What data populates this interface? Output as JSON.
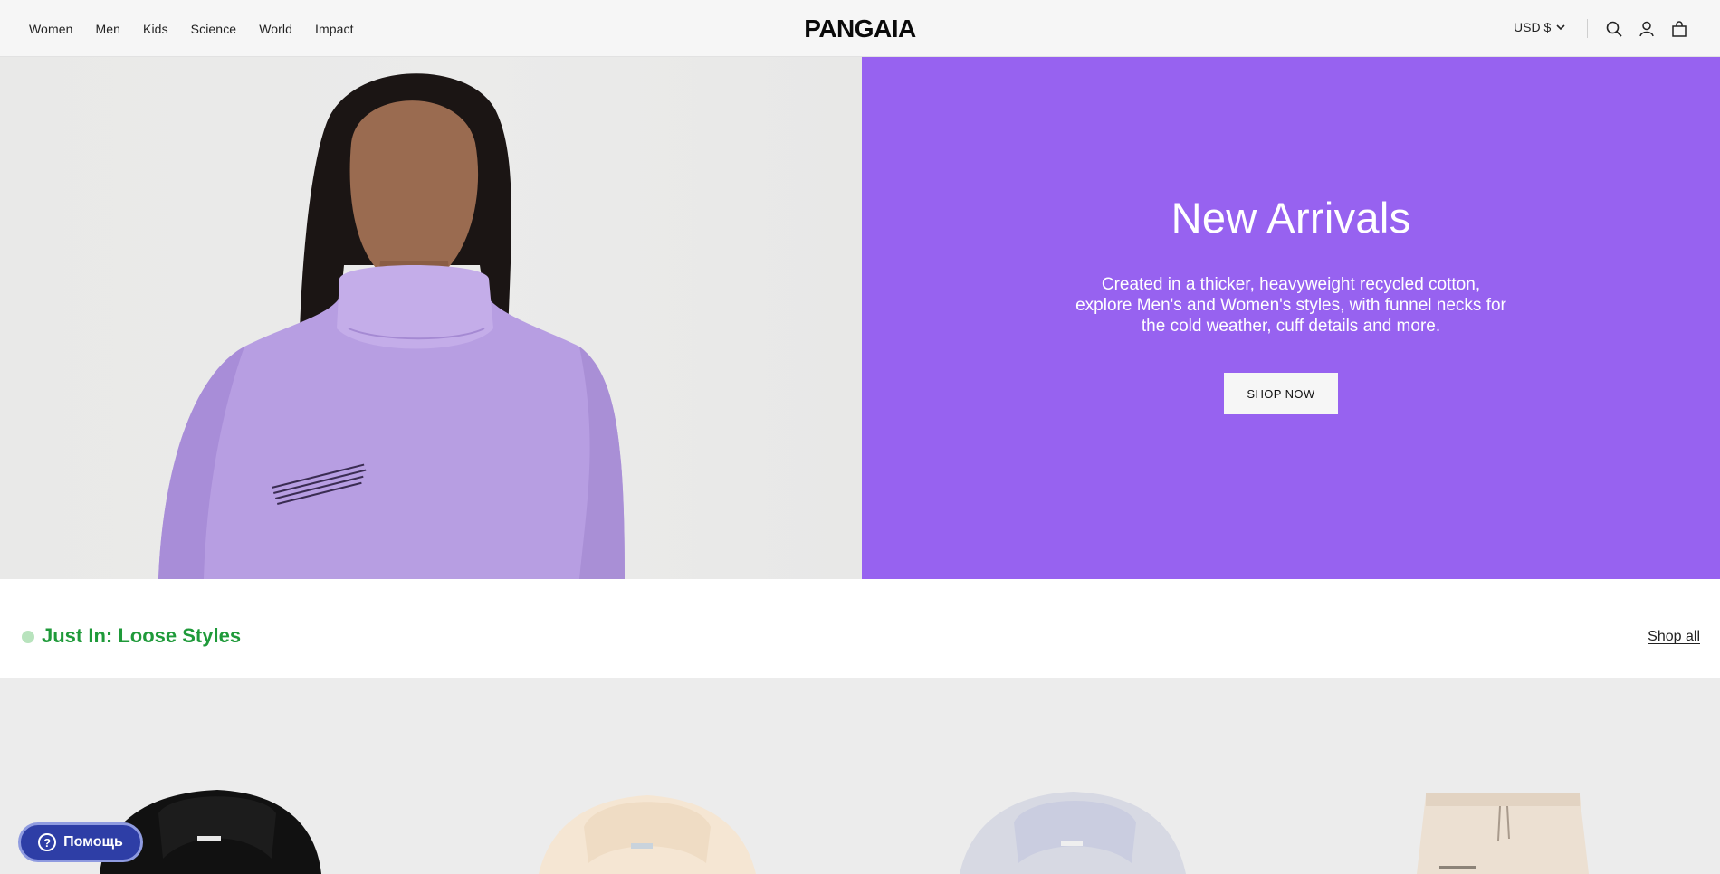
{
  "header": {
    "nav": [
      "Women",
      "Men",
      "Kids",
      "Science",
      "World",
      "Impact"
    ],
    "logo": "PANGAIA",
    "currency": "USD $",
    "icons": [
      "search-icon",
      "account-icon",
      "bag-icon"
    ]
  },
  "hero": {
    "title": "New Arrivals",
    "text": "Created in a thicker, heavyweight recycled cotton, explore Men's and Women's styles, with funnel necks for the cold weather, cuff details and more.",
    "button": "SHOP NOW",
    "panel_color": "#9762f0"
  },
  "section": {
    "title": "Just In: Loose Styles",
    "shop_all": "Shop all",
    "accent": "#1f9a3a"
  },
  "help": {
    "label": "Помощь",
    "icon": "question-icon"
  }
}
